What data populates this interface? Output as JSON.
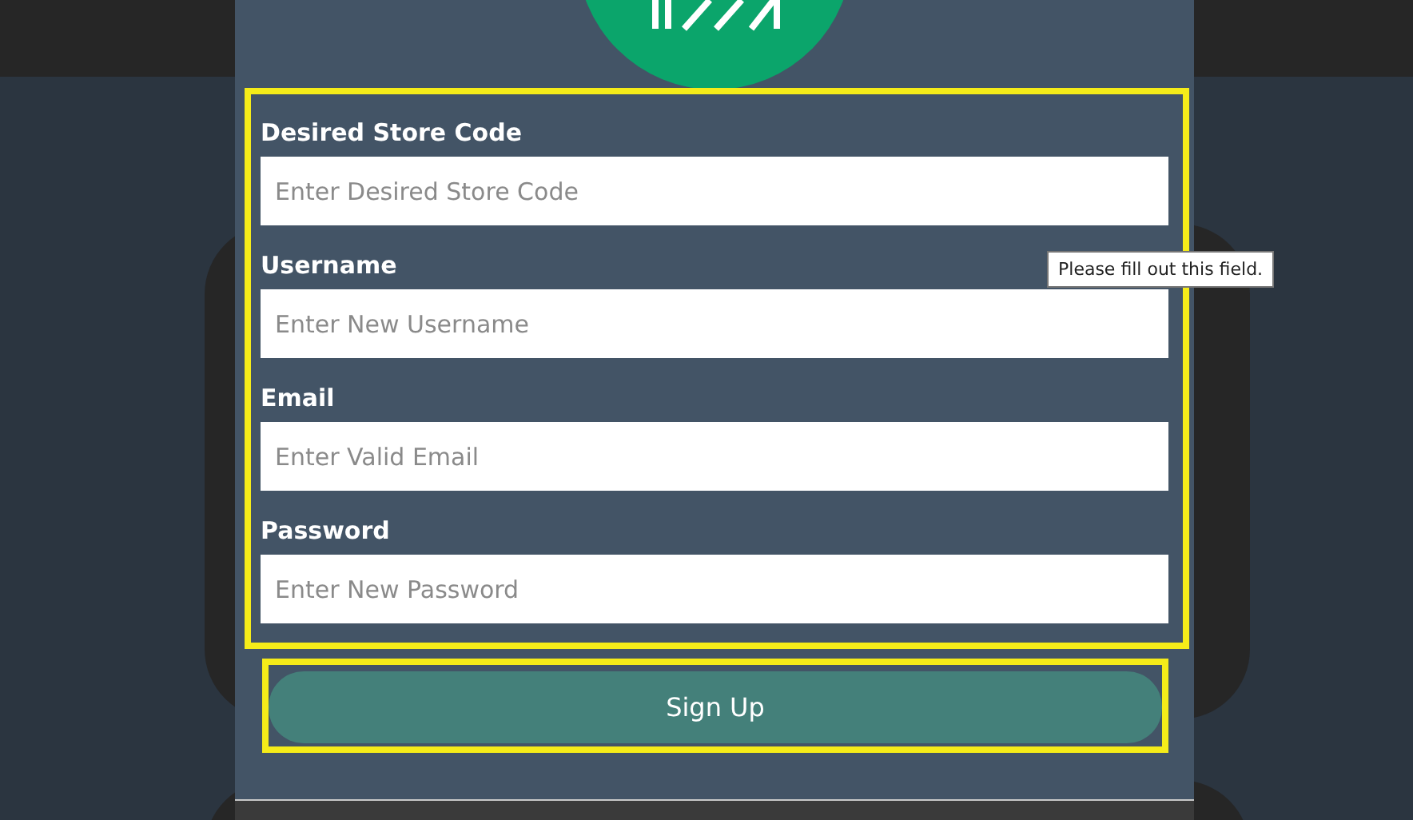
{
  "form": {
    "fields": [
      {
        "label": "Desired Store Code",
        "placeholder": "Enter Desired Store Code"
      },
      {
        "label": "Username",
        "placeholder": "Enter New Username"
      },
      {
        "label": "Email",
        "placeholder": "Enter Valid Email"
      },
      {
        "label": "Password",
        "placeholder": "Enter New Password"
      }
    ],
    "submit": "Sign Up"
  },
  "tooltip": "Please fill out this field."
}
